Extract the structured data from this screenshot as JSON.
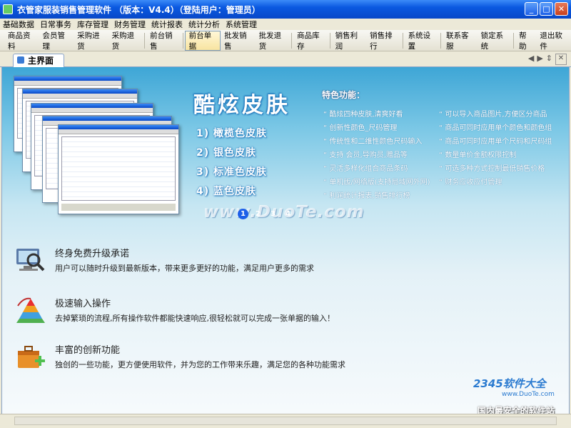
{
  "window": {
    "title": "衣管家服装销售管理软件 （版本：V4.4）（登陆用户：管理员）"
  },
  "menu": [
    "基础数据",
    "日常事务",
    "库存管理",
    "财务管理",
    "统计报表",
    "统计分析",
    "系统管理"
  ],
  "toolbar": [
    {
      "label": "商品资料",
      "icon": "palette-icon",
      "color": "#E89020"
    },
    {
      "label": "会员管理",
      "icon": "member-icon",
      "color": "#4A8AD8"
    },
    {
      "label": "采购进货",
      "icon": "truck-icon",
      "color": "#5AA0D8"
    },
    {
      "label": "采购退货",
      "icon": "return-icon",
      "color": "#D83030"
    },
    {
      "label": "前台销售",
      "icon": "register-icon",
      "color": "#C82828"
    },
    {
      "label": "前台单据",
      "icon": "receipt-icon",
      "color": "#8AA8C8"
    },
    {
      "label": "批发销售",
      "icon": "clipboard-icon",
      "color": "#C8A040"
    },
    {
      "label": "批发退货",
      "icon": "stop-icon",
      "color": "#D82828"
    },
    {
      "label": "商品库存",
      "icon": "boxes-icon",
      "color": "#58A848"
    },
    {
      "label": "销售利润",
      "icon": "pie-chart-icon",
      "color": "#D04878"
    },
    {
      "label": "销售排行",
      "icon": "bar-chart-icon",
      "color": "#D86020"
    },
    {
      "label": "系统设置",
      "icon": "gear-icon",
      "color": "#3870C8"
    },
    {
      "label": "联系客服",
      "icon": "qq-penguin-icon",
      "color": "#222222"
    },
    {
      "label": "锁定系统",
      "icon": "lock-icon",
      "color": "#4880C8"
    },
    {
      "label": "帮助",
      "icon": "help-icon",
      "color": "#2858B8"
    },
    {
      "label": "退出软件",
      "icon": "exit-icon",
      "color": "#58A048"
    }
  ],
  "tab": {
    "label": "主界面"
  },
  "hero": {
    "title": "酷炫皮肤",
    "skins": [
      "1) 橄榄色皮肤",
      "2) 银色皮肤",
      "3) 标准色皮肤",
      "4) 蓝色皮肤"
    ],
    "features_heading": "特色功能：",
    "features_left": [
      "酷炫四种皮肤,清爽好看",
      "创新性颜色_尺码管理",
      "传统性和二维性颜色尺码输入",
      "支持 会员,导购员,赠品等",
      "灵活多样化组合商品条码",
      "单机版/网络版(支持局域网外网)",
      "利润统计报表,销售排行榜"
    ],
    "features_right": [
      "可以导入商品图片,方便区分商品",
      "商品可同时应用单个颜色和颜色组",
      "商品可同时应用单个尺码和尺码组",
      "数量单价金额权限控制",
      "可选多种方式控制最低销售价格",
      "财务应收应付管理"
    ],
    "pager": [
      "1",
      "2",
      "3",
      "4"
    ],
    "watermark": "www.DuoTe.com"
  },
  "features": [
    {
      "title": "终身免费升级承诺",
      "desc": "用户可以随时升级到最新版本，带来更多更好的功能，满足用户更多的需求",
      "icon": "computer-search-icon"
    },
    {
      "title": "极速输入操作",
      "desc": "去掉繁琐的流程,所有操作软件都能快速响应,很轻松就可以完成一张单据的输入！",
      "icon": "pyramid-icon"
    },
    {
      "title": "丰富的创新功能",
      "desc": "独创的一些功能，更方便使用软件，并为您的工作带来乐趣，满足您的各种功能需求",
      "icon": "toolbox-add-icon"
    }
  ],
  "brand": {
    "name": "2345软件大全",
    "url": "www.DuoTe.com",
    "slogan": "国内最安全的软件站"
  }
}
